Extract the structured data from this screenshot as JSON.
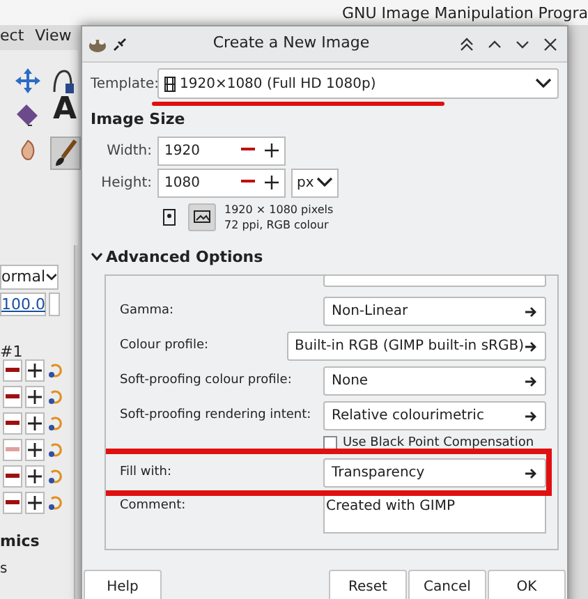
{
  "background_window": {
    "title": "GNU Image Manipulation Progra",
    "menu": [
      "ect",
      "View"
    ],
    "text_tool_glyph": "A",
    "mode": "ormal",
    "opacity": "100.0",
    "layer": "#1",
    "dynamics_rows": [
      {
        "minus_enabled": true
      },
      {
        "minus_enabled": true
      },
      {
        "minus_enabled": true
      },
      {
        "minus_enabled": false
      },
      {
        "minus_enabled": true
      },
      {
        "minus_enabled": true
      }
    ],
    "section_label": "mics",
    "section_label_2": "s"
  },
  "dialog": {
    "title": "Create a New Image",
    "template": {
      "label": "Template:",
      "value": "1920×1080 (Full HD 1080p)",
      "underlined": true
    },
    "image_size": {
      "heading": "Image Size",
      "width": {
        "label": "Width:",
        "value": "1920"
      },
      "height": {
        "label": "Height:",
        "value": "1080"
      },
      "unit": "px",
      "orientation": [
        {
          "selected": false
        },
        {
          "selected": true
        }
      ],
      "info": [
        "1920 × 1080 pixels",
        "72 ppi, RGB colour"
      ]
    },
    "advanced": {
      "heading": "Advanced Options",
      "expanded": true,
      "options": [
        {
          "kind": "select",
          "label": "Gamma:",
          "value": "Non-Linear",
          "outlined": false
        },
        {
          "kind": "select",
          "label": "Colour profile:",
          "value": "Built-in RGB (GIMP built-in sRGB)",
          "outlined": false
        },
        {
          "kind": "select",
          "label": "Soft-proofing colour profile:",
          "value": "None",
          "outlined": false
        },
        {
          "kind": "select",
          "label": "Soft-proofing rendering intent:",
          "value": "Relative colourimetric",
          "outlined": false
        },
        {
          "kind": "checkbox",
          "label": "Use Black Point Compensation",
          "checked": false
        },
        {
          "kind": "select",
          "label": "Fill with:",
          "value": "Transparency",
          "outlined": true
        },
        {
          "kind": "text",
          "label": "Comment:",
          "value": "Created with GIMP"
        }
      ]
    },
    "buttons": [
      {
        "label": "Help"
      },
      {
        "label": "Reset"
      },
      {
        "label": "Cancel"
      },
      {
        "label": "OK"
      }
    ]
  }
}
